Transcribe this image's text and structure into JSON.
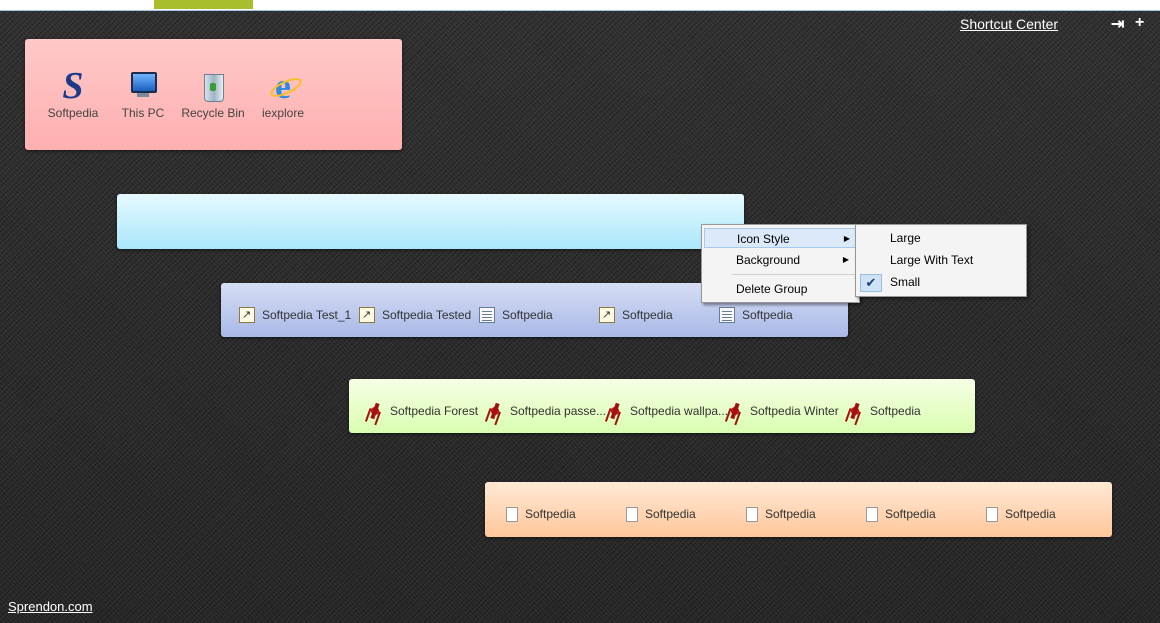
{
  "header": {
    "title": "Shortcut Center",
    "pin_icon": "pin-icon",
    "add_icon": "plus-icon"
  },
  "footer": {
    "link": "Sprendon.com"
  },
  "groups": {
    "desktop": {
      "items": [
        {
          "label": "Softpedia",
          "icon": "softpedia-s-icon"
        },
        {
          "label": "This PC",
          "icon": "computer-icon"
        },
        {
          "label": "Recycle Bin",
          "icon": "recycle-bin-icon"
        },
        {
          "label": "iexplore",
          "icon": "internet-explorer-icon"
        }
      ]
    },
    "blue": {
      "items": [
        {
          "label": "Softpedia Test_1",
          "icon": "shortcut-icon"
        },
        {
          "label": "Softpedia Tested",
          "icon": "shortcut-icon"
        },
        {
          "label": "Softpedia",
          "icon": "document-icon"
        },
        {
          "label": "Softpedia",
          "icon": "shortcut-icon"
        },
        {
          "label": "Softpedia",
          "icon": "document-icon"
        }
      ]
    },
    "green": {
      "items": [
        {
          "label": "Softpedia Forest",
          "icon": "image-icon"
        },
        {
          "label": "Softpedia passe...",
          "icon": "image-icon"
        },
        {
          "label": "Softpedia wallpa...",
          "icon": "image-icon"
        },
        {
          "label": "Softpedia Winter",
          "icon": "image-icon"
        },
        {
          "label": "Softpedia",
          "icon": "image-icon"
        }
      ]
    },
    "orange": {
      "items": [
        {
          "label": "Softpedia",
          "icon": "file-icon"
        },
        {
          "label": "Softpedia",
          "icon": "file-icon"
        },
        {
          "label": "Softpedia",
          "icon": "file-icon"
        },
        {
          "label": "Softpedia",
          "icon": "file-icon"
        },
        {
          "label": "Softpedia",
          "icon": "file-icon"
        }
      ]
    }
  },
  "context_menu": {
    "items": [
      {
        "label": "Icon Style",
        "submenu": true,
        "highlighted": true
      },
      {
        "label": "Background",
        "submenu": true
      },
      {
        "label": "Delete Group"
      }
    ]
  },
  "submenu": {
    "items": [
      {
        "label": "Large"
      },
      {
        "label": "Large With Text"
      },
      {
        "label": "Small",
        "checked": true
      }
    ]
  },
  "colors": {
    "desktop_group": "#ffb8b8",
    "cyan_group": "#b8ebfc",
    "blue_group": "#b5c3eb",
    "green_group": "#e2fdc4",
    "orange_group": "#ffd3b0",
    "top_accent": "#a9bd2d"
  }
}
